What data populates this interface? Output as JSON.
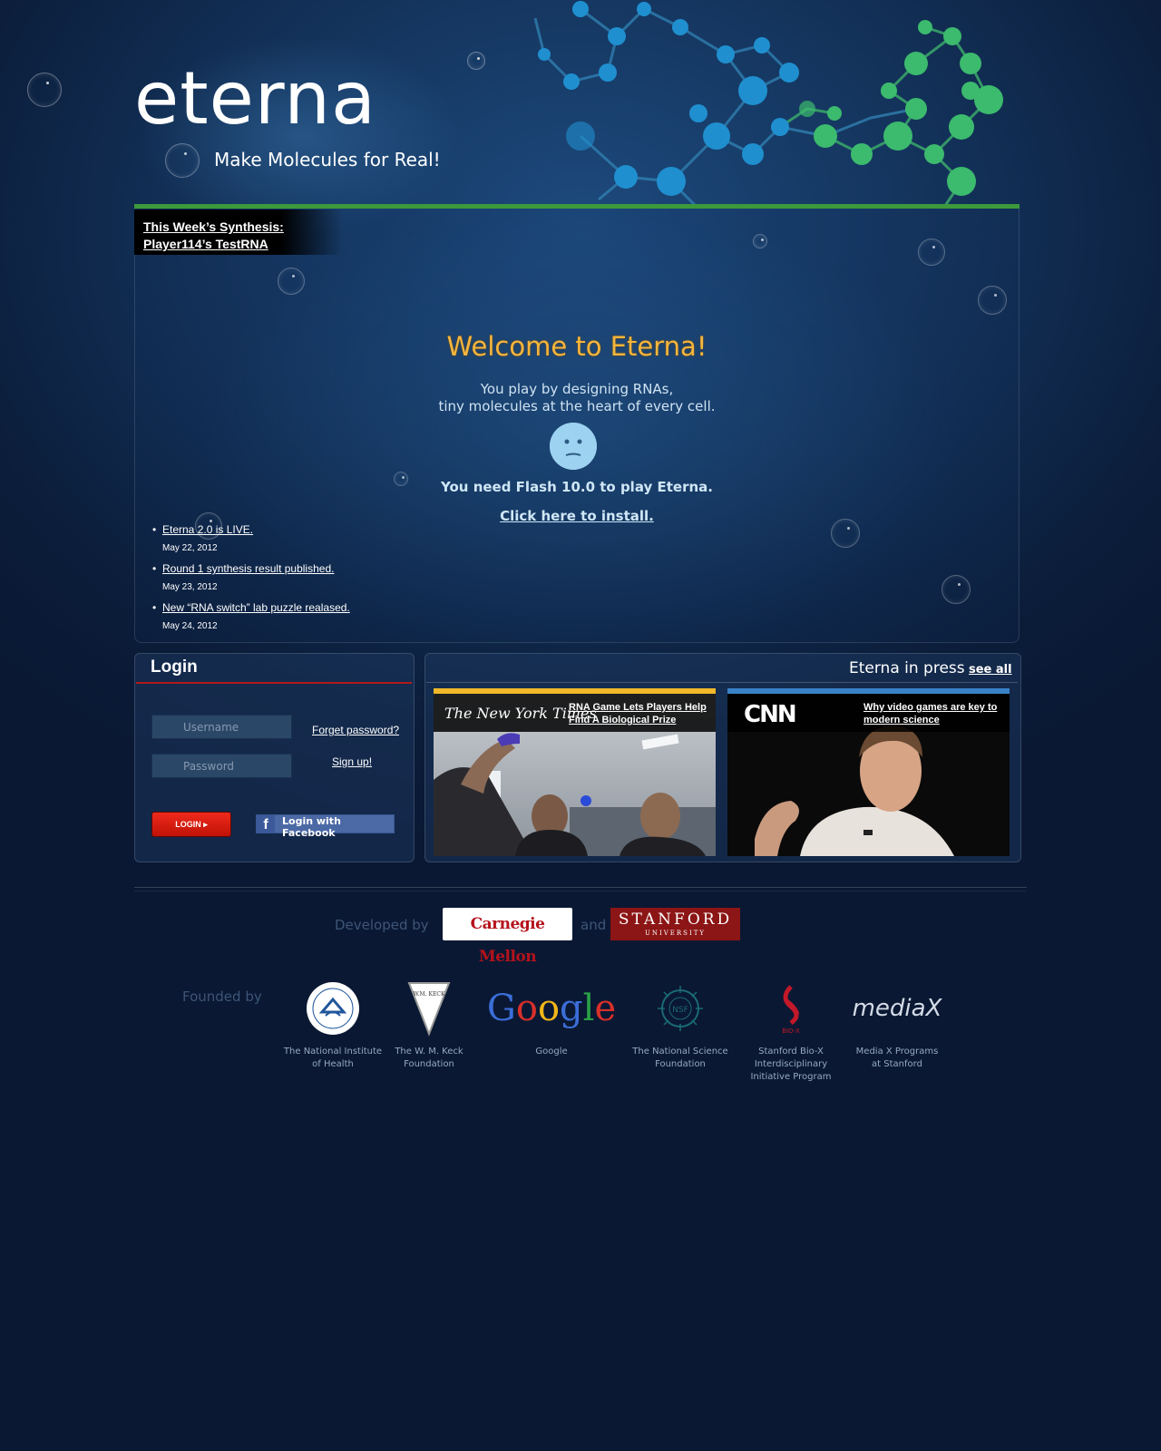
{
  "header": {
    "logo": "eterna",
    "tagline": "Make Molecules for Real!"
  },
  "synthesis": {
    "line1": "This Week’s Synthesis:",
    "line2": "Player114’s TestRNA"
  },
  "welcome": {
    "title": "Welcome to Eterna!",
    "intro_line1": "You play by designing RNAs,",
    "intro_line2": "tiny molecules at the heart of every cell.",
    "flash_message": "You need Flash 10.0 to play Eterna.",
    "install_link": "Click here to install."
  },
  "news": [
    {
      "title": "Eterna 2.0 is LIVE.",
      "date": "May 22, 2012"
    },
    {
      "title": "Round 1 synthesis result published.",
      "date": "May 23, 2012"
    },
    {
      "title": "New “RNA switch” lab puzzle realased.",
      "date": "May 24, 2012"
    }
  ],
  "login": {
    "title": "Login",
    "username_placeholder": "Username",
    "password_placeholder": "Password",
    "forget_password": "Forget password?",
    "sign_up": "Sign up!",
    "login_button": "LOGIN ▸",
    "facebook_button": "Login with Facebook",
    "facebook_icon": "f"
  },
  "press": {
    "title": "Eterna in press",
    "see_all": "see all",
    "items": [
      {
        "source": "The New York Times",
        "headline_line1": "RNA Game Lets Players Help",
        "headline_line2": "Find A Biological Prize",
        "accent": "#f1b82a"
      },
      {
        "source": "CNN",
        "headline_line1": "Why video games are key to",
        "headline_line2": "modern science",
        "accent": "#3a82c8"
      }
    ]
  },
  "footer": {
    "developed_by": "Developed by",
    "and": "and",
    "cmu": "Carnegie Mellon",
    "stanford_line1": "STANFORD",
    "stanford_line2": "UNIVERSITY",
    "founded_by": "Founded by",
    "sponsors": [
      {
        "name_line1": "The National Institute",
        "name_line2": "of Health",
        "name_line3": ""
      },
      {
        "name_line1": "The W. M. Keck",
        "name_line2": "Foundation",
        "name_line3": ""
      },
      {
        "name_line1": "Google",
        "name_line2": "",
        "name_line3": ""
      },
      {
        "name_line1": "The National Science",
        "name_line2": "Foundation",
        "name_line3": ""
      },
      {
        "name_line1": "Stanford Bio-X",
        "name_line2": "Interdisciplinary",
        "name_line3": "Initiative Program"
      },
      {
        "name_line1": "Media X Programs",
        "name_line2": "at Stanford",
        "name_line3": ""
      }
    ],
    "google_logo": "Google",
    "mediax_logo": "mediaX",
    "keck_logo": "W.M. KECK",
    "nsf_logo": "NSF",
    "biox_logo": "BIO-X"
  },
  "colors": {
    "welcome_title": "#f5b53d",
    "green_bar": "#3c9a3c",
    "login_rule": "#b11a1a",
    "login_button": "#e0200f",
    "facebook": "#4b69a5",
    "cmu_red": "#b5121b",
    "stanford_red": "#8c1515"
  }
}
